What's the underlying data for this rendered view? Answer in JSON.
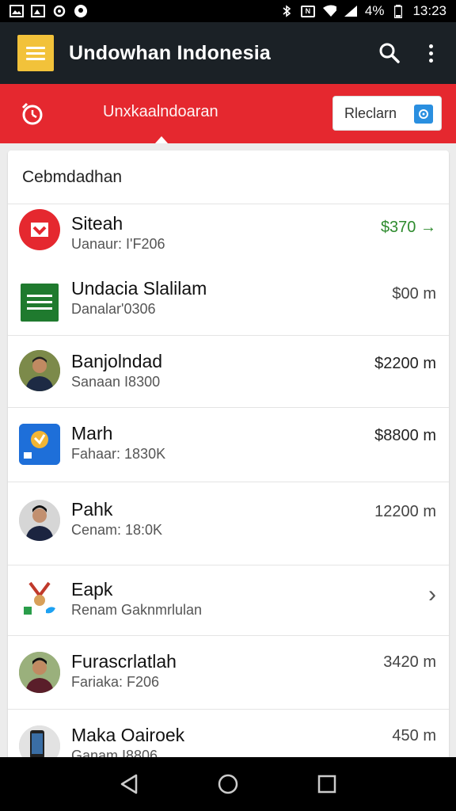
{
  "status_bar": {
    "battery": "4%",
    "time": "13:23",
    "icons": [
      "gallery-icon",
      "photo-icon",
      "sync-icon",
      "location-icon",
      "bluetooth-icon",
      "nfc-icon",
      "wifi-icon",
      "signal-icon",
      "battery-icon"
    ]
  },
  "appbar": {
    "title": "Undowhan Indonesia",
    "icons": [
      "menu-icon",
      "search-icon",
      "more-vert-icon"
    ]
  },
  "redbar": {
    "tab_label": "Unxkaalndoaran",
    "redeem_label": "Rleclarn"
  },
  "card": {
    "header": "Cebmdadhan",
    "rows": [
      {
        "name": "Siteah",
        "sub": "Uanaur: I'F206",
        "amount": "$370 →",
        "avatar": "red-download-icon",
        "accent": "#2e8b2e"
      },
      {
        "name": "Undacia Slalilam",
        "sub": "Danalar'0306",
        "amount": "$00 m",
        "avatar": "green-logo"
      },
      {
        "name": "Banjolndad",
        "sub": "Sanaan I8300",
        "amount": "$2200 m",
        "avatar": "person-photo"
      },
      {
        "name": "Marh",
        "sub": "Fahaar: 1830K",
        "amount": "$8800 m",
        "avatar": "blue-app-icon"
      },
      {
        "name": "Pahk",
        "sub": "Cenam: 18:0K",
        "amount": "12200 m",
        "avatar": "person-photo"
      },
      {
        "name": "Eapk",
        "sub": "Renam Gaknmrlulan",
        "amount": "›",
        "avatar": "social-logos"
      },
      {
        "name": "Furascrlatlah",
        "sub": "Fariaka: F206",
        "amount": "3420 m",
        "avatar": "person-photo"
      },
      {
        "name": "Maka Oairoek",
        "sub": "Ganam I8806",
        "amount": "450 m",
        "avatar": "phone-photo"
      }
    ]
  },
  "colors": {
    "appbar": "#1b2126",
    "menu_button": "#f2c23a",
    "accent_red": "#e5282f",
    "positive_green": "#2e8b2e"
  }
}
